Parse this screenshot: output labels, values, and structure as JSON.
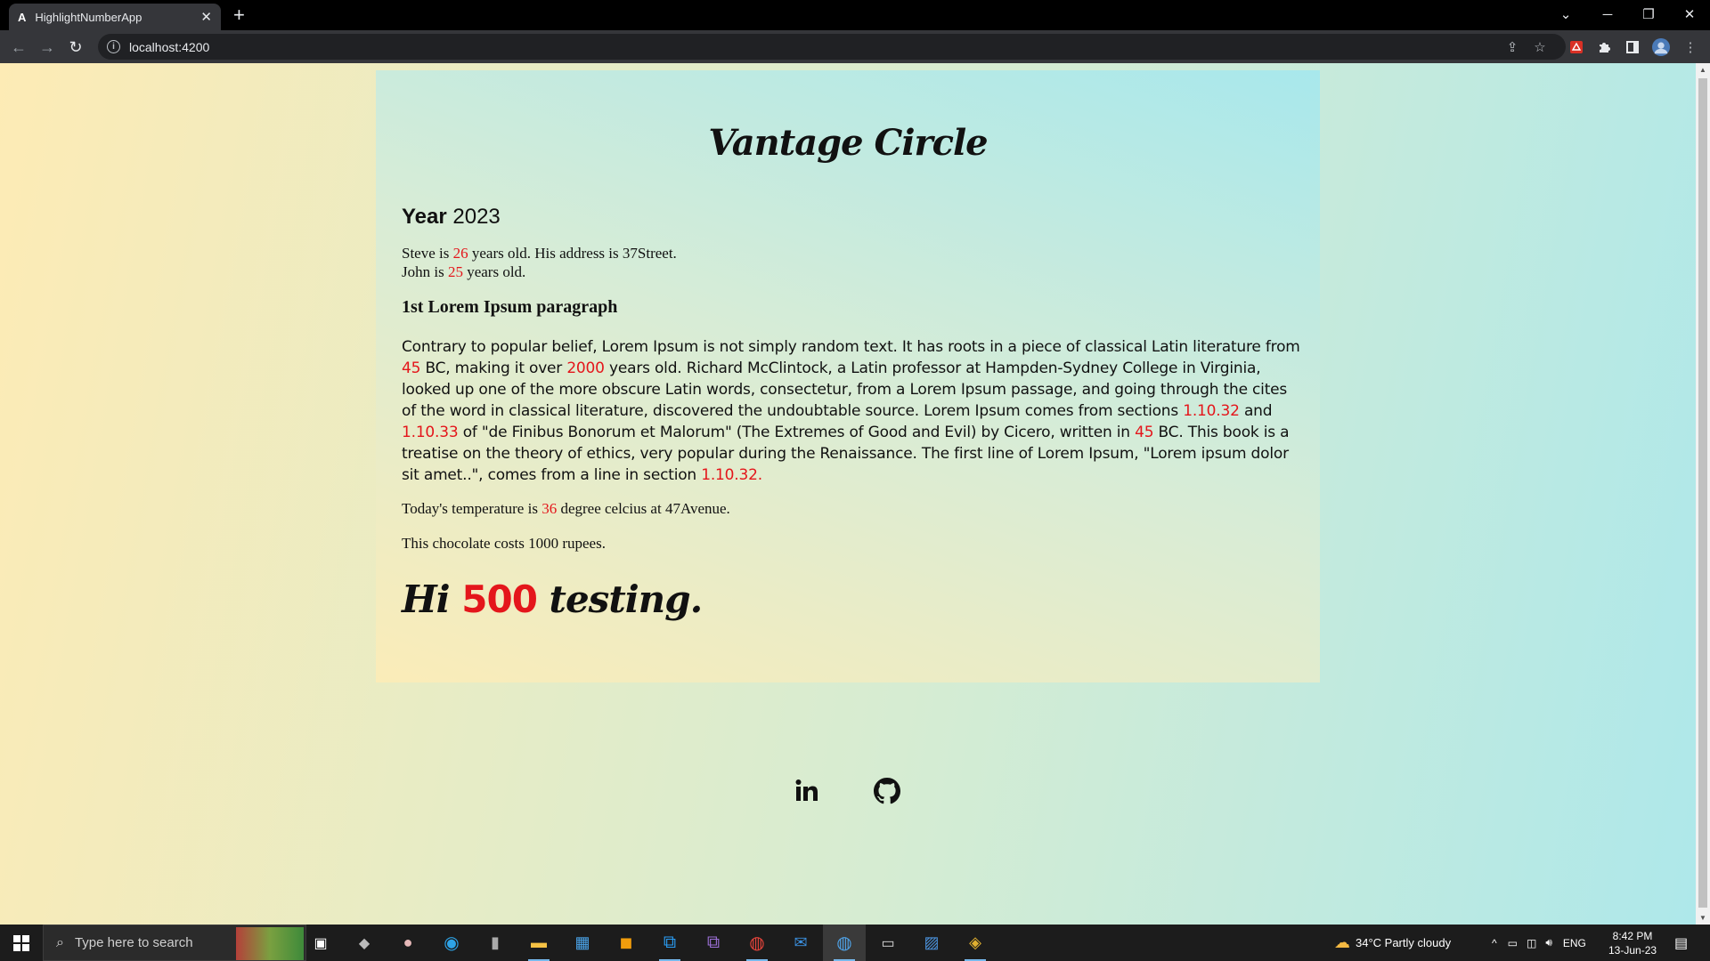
{
  "browser": {
    "tab_title": "HighlightNumberApp",
    "tab_favicon": "A",
    "url": "localhost:4200"
  },
  "page": {
    "brand": "Vantage Circle",
    "year_label": "Year",
    "year_value": "2023",
    "line1": {
      "a": "Steve is ",
      "n": "26",
      "b": " years old. His address is 37Street."
    },
    "line2": {
      "a": "John is ",
      "n": "25",
      "b": " years old."
    },
    "heading": "1st Lorem Ipsum paragraph",
    "paragraph": [
      {
        "t": "Contrary to popular belief, Lorem Ipsum is not simply random text. It has roots in a piece of classical Latin literature from "
      },
      {
        "n": "45"
      },
      {
        "t": " BC, making it over "
      },
      {
        "n": "2000"
      },
      {
        "t": " years old. Richard McClintock, a Latin professor at Hampden-Sydney College in Virginia, looked up one of the more obscure Latin words, consectetur, from a Lorem Ipsum passage, and going through the cites of the word in classical literature, discovered the undoubtable source. Lorem Ipsum comes from sections "
      },
      {
        "n": "1.10.32"
      },
      {
        "t": " and "
      },
      {
        "n": "1.10.33"
      },
      {
        "t": " of \"de Finibus Bonorum et Malorum\" (The Extremes of Good and Evil) by Cicero, written in "
      },
      {
        "n": "45"
      },
      {
        "t": " BC. This book is a treatise on the theory of ethics, very popular during the Renaissance. The first line of Lorem Ipsum, \"Lorem ipsum dolor sit amet..\", comes from a line in section "
      },
      {
        "n": "1.10.32."
      }
    ],
    "temperature": {
      "a": "Today's temperature is ",
      "n": "36",
      "b": " degree celcius at 47Avenue."
    },
    "chocolate": "This chocolate costs 1000 rupees.",
    "hi": {
      "a": "Hi ",
      "n": "500",
      "b": " testing."
    },
    "highlight_color": "#e4161b"
  },
  "taskbar": {
    "search_placeholder": "Type here to search",
    "weather": "34°C  Partly cloudy",
    "language": "ENG",
    "time": "8:42 PM",
    "date": "13-Jun-23"
  }
}
